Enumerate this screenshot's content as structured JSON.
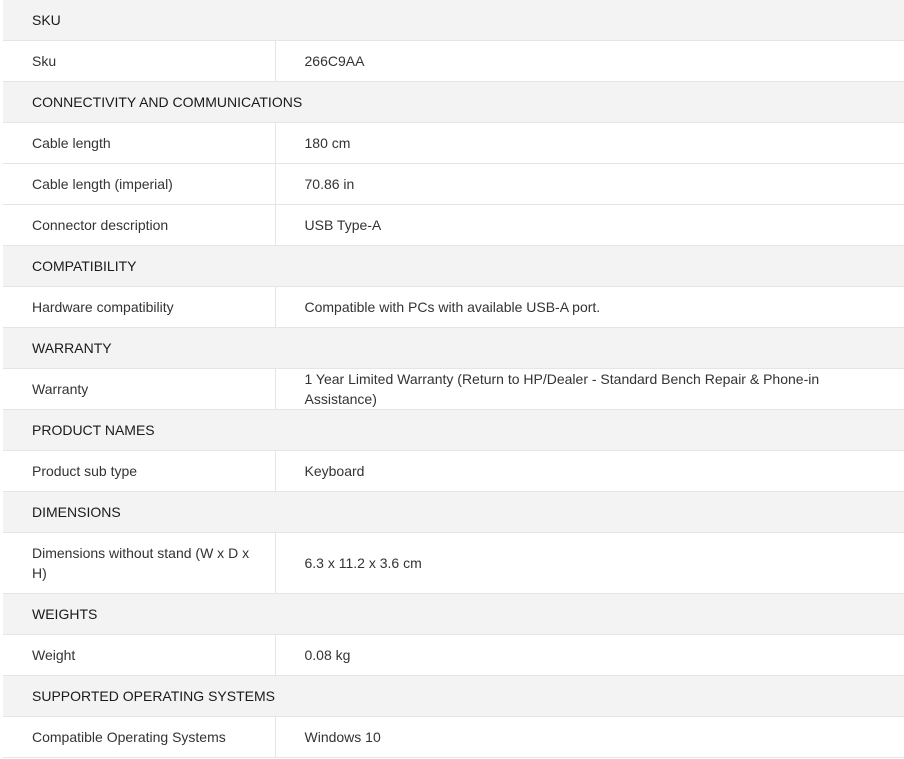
{
  "sections": [
    {
      "title": "SKU",
      "rows": [
        {
          "label": "Sku",
          "value": "266C9AA"
        }
      ]
    },
    {
      "title": "CONNECTIVITY AND COMMUNICATIONS",
      "rows": [
        {
          "label": "Cable length",
          "value": "180 cm"
        },
        {
          "label": "Cable length (imperial)",
          "value": "70.86 in"
        },
        {
          "label": "Connector description",
          "value": "USB Type-A"
        }
      ]
    },
    {
      "title": "COMPATIBILITY",
      "rows": [
        {
          "label": "Hardware compatibility",
          "value": "Compatible with PCs with available USB-A port."
        }
      ]
    },
    {
      "title": "WARRANTY",
      "rows": [
        {
          "label": "Warranty",
          "value": "1 Year Limited Warranty (Return to HP/Dealer - Standard Bench Repair & Phone-in Assistance)"
        }
      ]
    },
    {
      "title": "PRODUCT NAMES",
      "rows": [
        {
          "label": "Product sub type",
          "value": "Keyboard"
        }
      ]
    },
    {
      "title": "DIMENSIONS",
      "rows": [
        {
          "label": "Dimensions without stand (W x D x H)",
          "value": "6.3 x 11.2 x 3.6 cm"
        }
      ]
    },
    {
      "title": "WEIGHTS",
      "rows": [
        {
          "label": "Weight",
          "value": "0.08 kg"
        }
      ]
    },
    {
      "title": "SUPPORTED OPERATING SYSTEMS",
      "rows": [
        {
          "label": "Compatible Operating Systems",
          "value": "Windows 10"
        }
      ]
    }
  ]
}
